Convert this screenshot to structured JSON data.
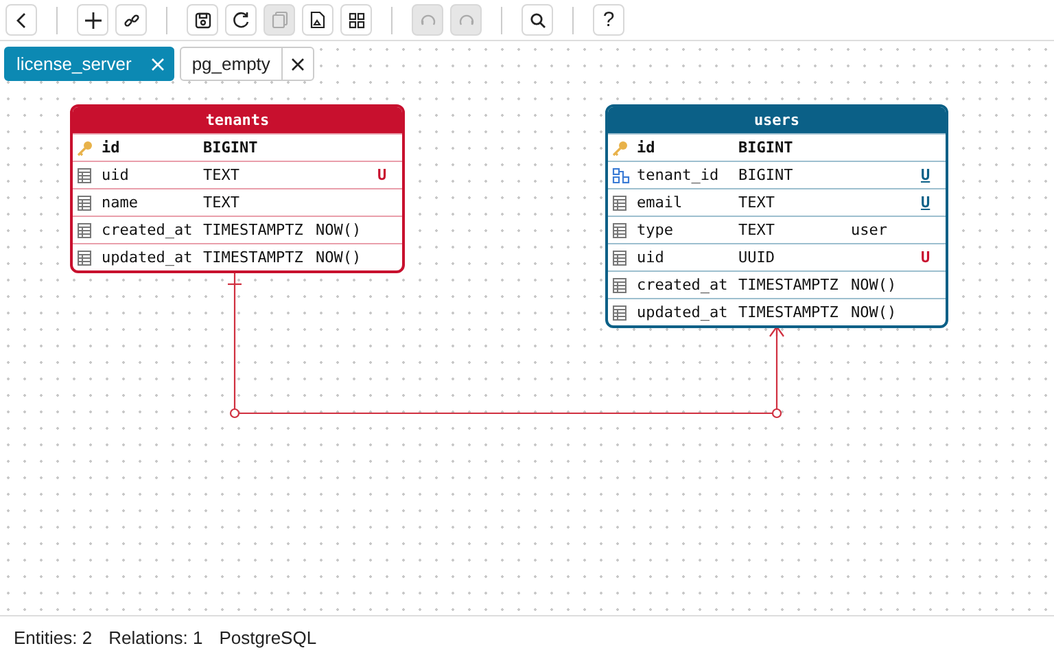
{
  "toolbar": [
    {
      "kind": "back",
      "disabled": false
    },
    {
      "kind": "add",
      "disabled": false
    },
    {
      "kind": "link",
      "disabled": false
    },
    {
      "kind": "save",
      "disabled": false
    },
    {
      "kind": "refresh",
      "disabled": false
    },
    {
      "kind": "copy",
      "disabled": true
    },
    {
      "kind": "export",
      "disabled": false
    },
    {
      "kind": "grid",
      "disabled": false
    },
    {
      "kind": "undo",
      "disabled": true
    },
    {
      "kind": "redo",
      "disabled": true
    },
    {
      "kind": "search",
      "disabled": false
    },
    {
      "kind": "help",
      "label": "?",
      "disabled": false
    }
  ],
  "tabs": [
    {
      "label": "license_server",
      "selected": true
    },
    {
      "label": "pg_empty",
      "selected": false
    }
  ],
  "entities": [
    {
      "title": "tenants",
      "color": "#c8102e",
      "columns": [
        {
          "kind": "pk",
          "name": "id",
          "type": "BIGINT"
        },
        {
          "kind": "col",
          "name": "uid",
          "type": "TEXT",
          "unique": "U",
          "color": "#c8102e",
          "underlined": false
        },
        {
          "kind": "col",
          "name": "name",
          "type": "TEXT"
        },
        {
          "kind": "col",
          "name": "created_at",
          "type": "TIMESTAMPTZ",
          "default": "NOW()"
        },
        {
          "kind": "col",
          "name": "updated_at",
          "type": "TIMESTAMPTZ",
          "default": "NOW()"
        }
      ]
    },
    {
      "title": "users",
      "color": "#0b6087",
      "columns": [
        {
          "kind": "pk",
          "name": "id",
          "type": "BIGINT"
        },
        {
          "kind": "fk",
          "name": "tenant_id",
          "type": "BIGINT",
          "unique": "U",
          "color": "#0b6087",
          "underlined": true
        },
        {
          "kind": "col",
          "name": "email",
          "type": "TEXT",
          "unique": "U",
          "color": "#0b6087",
          "underlined": true
        },
        {
          "kind": "col",
          "name": "type",
          "type": "TEXT",
          "default": "user"
        },
        {
          "kind": "col",
          "name": "uid",
          "type": "UUID",
          "unique": "U",
          "color": "#c8102e",
          "underlined": false
        },
        {
          "kind": "col",
          "name": "created_at",
          "type": "TIMESTAMPTZ",
          "default": "NOW()"
        },
        {
          "kind": "col",
          "name": "updated_at",
          "type": "TIMESTAMPTZ",
          "default": "NOW()"
        }
      ]
    }
  ],
  "status_bar": {
    "entities": "Entities: 2",
    "relations": "Relations: 1",
    "dialect": "PostgreSQL"
  }
}
